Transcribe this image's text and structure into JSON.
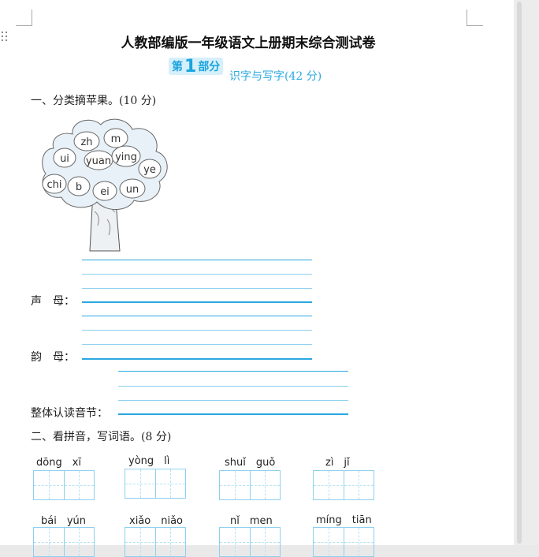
{
  "title": "人教部编版一年级语文上册期末综合测试卷",
  "section_badge": {
    "prefix": "第",
    "number": "1",
    "suffix": "部分"
  },
  "section_subtitle": "识字与写字(42 分)",
  "q1": {
    "label": "一、分类摘苹果。(10 分)",
    "apples": [
      "zh",
      "m",
      "ui",
      "yuan",
      "ying",
      "ye",
      "chi",
      "b",
      "ei",
      "un"
    ],
    "answer_labels": {
      "shengmu": "声　母：",
      "yunmu": "韵　母：",
      "zhengti": "整体认读音节："
    }
  },
  "q2": {
    "label": "二、看拼音，写词语。(8 分)",
    "row1": [
      "dōng　xī",
      "yòng　lì",
      "shuǐ　guǒ",
      "zì　jǐ"
    ],
    "row2": [
      "bái　yún",
      "xiǎo　niǎo",
      "nǐ　men",
      "míng　tiān"
    ]
  },
  "colors": {
    "accent": "#2aa8e0",
    "badge_bg": "#d6f0fb"
  }
}
